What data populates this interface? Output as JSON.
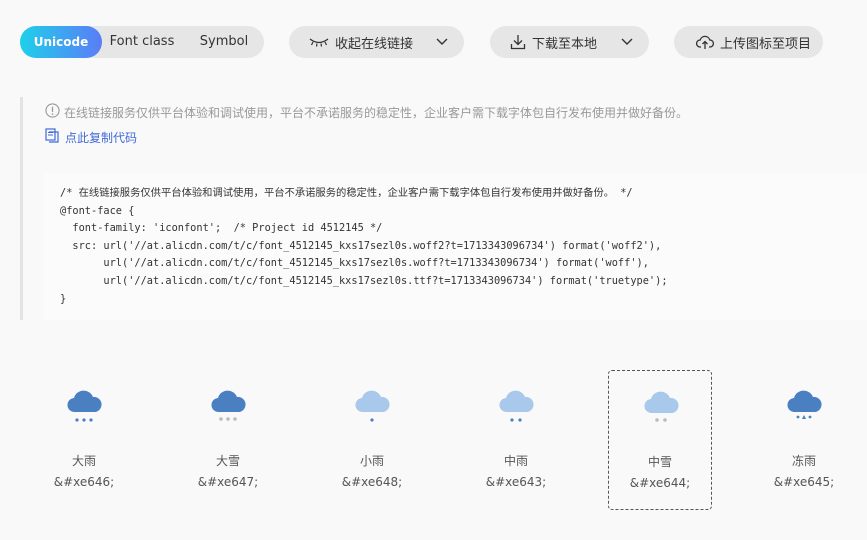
{
  "toolbar": {
    "tabs": [
      {
        "label": "Unicode",
        "active": true
      },
      {
        "label": "Font class",
        "active": false
      },
      {
        "label": "Symbol",
        "active": false
      }
    ],
    "collapse_label": "收起在线链接",
    "download_label": "下载至本地",
    "upload_label": "上传图标至项目",
    "icons": {
      "collapse": "closed-eye-icon",
      "download": "download-icon",
      "upload": "cloud-upload-icon",
      "dropdown": "chevron-down-icon"
    }
  },
  "notice": {
    "tip": "在线链接服务仅供平台体验和调试使用，平台不承诺服务的稳定性，企业客户需下载字体包自行发布使用并做好备份。",
    "copy_label": "点此复制代码",
    "code_lines": [
      "/* 在线链接服务仅供平台体验和调试使用，平台不承诺服务的稳定性，企业客户需下载字体包自行发布使用并做好备份。 */",
      "@font-face {",
      "  font-family: 'iconfont';  /* Project id 4512145 */",
      "  src: url('//at.alicdn.com/t/c/font_4512145_kxs17sezl0s.woff2?t=1713343096734') format('woff2'),",
      "       url('//at.alicdn.com/t/c/font_4512145_kxs17sezl0s.woff?t=1713343096734') format('woff'),",
      "       url('//at.alicdn.com/t/c/font_4512145_kxs17sezl0s.ttf?t=1713343096734') format('truetype');",
      "}"
    ]
  },
  "icons": [
    {
      "name": "大雨",
      "code": "&#xe646;",
      "glyph": "heavy-rain-icon",
      "cloud_color": "#4a7fc1",
      "drop_color": "#4a7fc1",
      "selected": false
    },
    {
      "name": "大雪",
      "code": "&#xe647;",
      "glyph": "heavy-snow-icon",
      "cloud_color": "#4a7fc1",
      "drop_color": "#bbbbbb",
      "selected": false
    },
    {
      "name": "小雨",
      "code": "&#xe648;",
      "glyph": "light-rain-icon",
      "cloud_color": "#a9c9ec",
      "drop_color": "#4a7fc1",
      "selected": false
    },
    {
      "name": "中雨",
      "code": "&#xe643;",
      "glyph": "moderate-rain-icon",
      "cloud_color": "#a9c9ec",
      "drop_color": "#4a7fc1",
      "selected": false
    },
    {
      "name": "中雪",
      "code": "&#xe644;",
      "glyph": "moderate-snow-icon",
      "cloud_color": "#a9c9ec",
      "drop_color": "#bbbbbb",
      "selected": true
    },
    {
      "name": "冻雨",
      "code": "&#xe645;",
      "glyph": "freezing-rain-icon",
      "cloud_color": "#4a7fc1",
      "drop_color": "#4a7fc1",
      "selected": false
    }
  ]
}
